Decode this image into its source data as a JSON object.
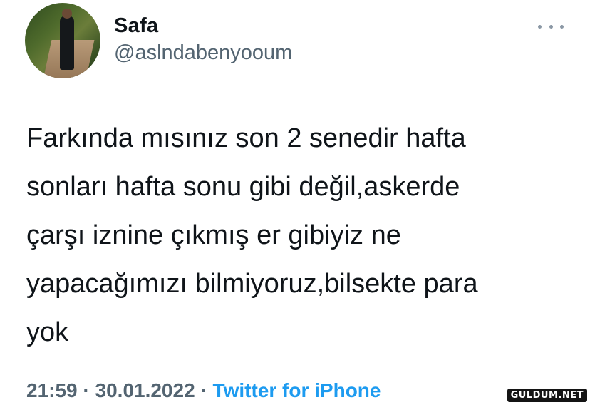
{
  "user": {
    "display_name": "Safa",
    "handle": "@aslndabenyooum",
    "avatar_icon": "user-avatar-photo"
  },
  "tweet": {
    "text": "Farkında mısınız son 2 senedir hafta\nsonları hafta sonu gibi değil,askerde\nçarşı iznine çıkmış er gibiyiz ne\nyapacağımızı bilmiyoruz,bilsekte para\nyok",
    "time": "21:59",
    "date": "30.01.2022",
    "separator": "·",
    "source": "Twitter for iPhone"
  },
  "menu": {
    "more_icon": "more-options-icon"
  },
  "watermark": "GULDUM.NET",
  "colors": {
    "link": "#1d9bf0",
    "secondary": "#536471",
    "text": "#0f1419"
  }
}
